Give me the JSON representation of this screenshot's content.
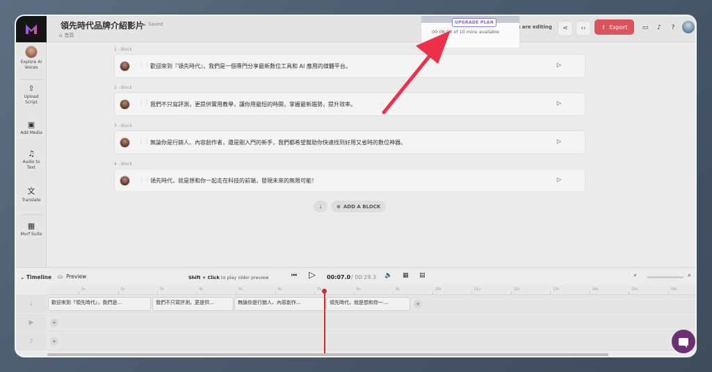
{
  "header": {
    "title": "領先時代品牌介紹影片",
    "saved_label": "Saved",
    "breadcrumb": "首頁",
    "upgrade_label": "UPGRADE PLAN",
    "minutes_text": "00:08:08 of 10 mins available",
    "editing_label": "You are editing",
    "export_label": "Export"
  },
  "sidebar": {
    "items": [
      {
        "label": "Explore AI Voices",
        "icon": "avatar"
      },
      {
        "label": "Upload Script",
        "icon": "upload-icon"
      },
      {
        "label": "Add Media",
        "icon": "media-icon"
      },
      {
        "label": "Audio to Text",
        "icon": "audio-text-icon"
      },
      {
        "label": "Translate",
        "icon": "translate-icon"
      },
      {
        "label": "Murf Suite",
        "icon": "suite-icon"
      }
    ]
  },
  "blocks": [
    {
      "label": "1 -  Block",
      "text": "歡迎來到『領先時代』，我們是一個專門分享最新數位工具和 AI 應用的媒體平台。"
    },
    {
      "label": "2 -  Block",
      "text": "我們不只寫評測，更提供實用教學，讓你用最短的時間，掌握最新趨勢，提升效率。"
    },
    {
      "label": "3 -  Block",
      "text": "無論你是行銷人、內容創作者，還是剛入門的新手，我們都希望幫助你快速找到好用又省時的數位神器。"
    },
    {
      "label": "4 -  Block",
      "text": "領先時代，就是想和你一起走在科技的前端，發現未來的無限可能！"
    }
  ],
  "add_block_label": "ADD A BLOCK",
  "timeline": {
    "title": "Timeline",
    "preview_label": "Preview",
    "shift_bold": "Shift + Click",
    "shift_rest": " to play older preview",
    "current_time": "00:07.0",
    "total_time": "/ 00:29.3",
    "ticks": [
      "1s",
      "2s",
      "3s",
      "4s",
      "5s",
      "6s",
      "7s",
      "8s",
      "9s",
      "10s",
      "11s",
      "12s",
      "13s",
      "14s",
      "15s",
      "16s"
    ],
    "clips": [
      "歡迎來到『領先時代』，我們是...",
      "我們不只寫評測，更提供...",
      "無論你是行銷人、內容創作...",
      "領先時代，就是想和你一..."
    ]
  },
  "colors": {
    "export_bg": "#d9545c",
    "upgrade_accent": "#7a67cf",
    "arrow": "#f0304a",
    "playhead": "#d22b2b",
    "chat": "#6b2f72"
  }
}
